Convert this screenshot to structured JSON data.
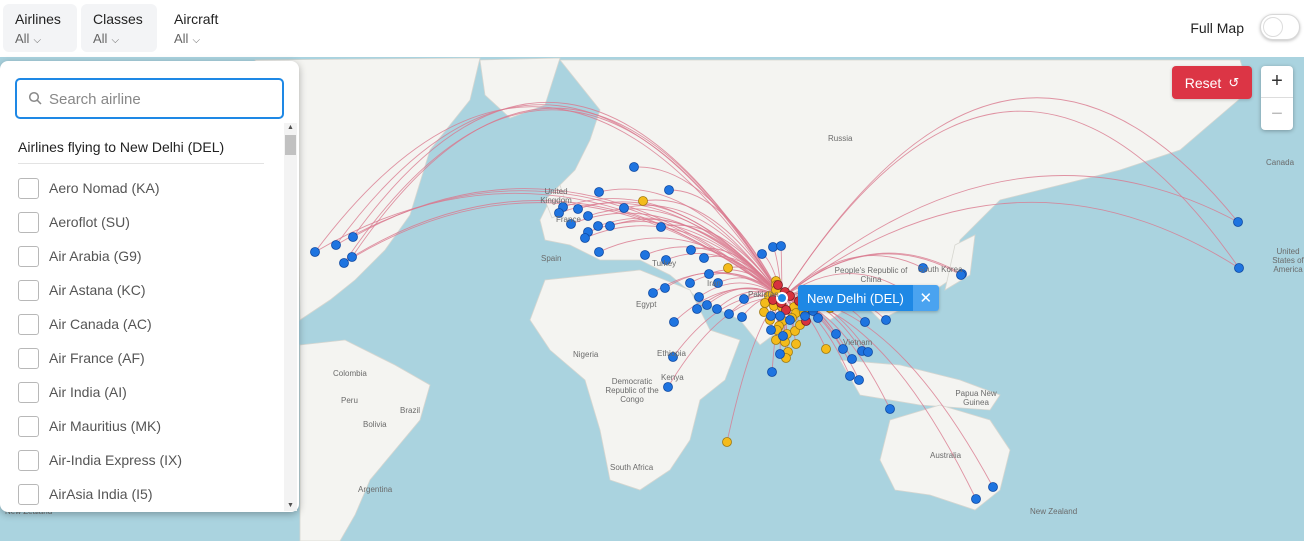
{
  "filters": [
    {
      "label": "Airlines",
      "value": "All"
    },
    {
      "label": "Classes",
      "value": "All"
    },
    {
      "label": "Aircraft",
      "value": "All"
    }
  ],
  "full_map": {
    "label": "Full Map",
    "enabled": false
  },
  "reset_label": "Reset",
  "zoom": {
    "in": "+",
    "out": "−"
  },
  "panel": {
    "search_placeholder": "Search airline",
    "title": "Airlines flying to New Delhi (DEL)",
    "items": [
      "Aero Nomad (KA)",
      "Aeroflot (SU)",
      "Air Arabia (G9)",
      "Air Astana (KC)",
      "Air Canada (AC)",
      "Air France (AF)",
      "Air India (AI)",
      "Air Mauritius (MK)",
      "Air-India Express (IX)",
      "AirAsia India (I5)"
    ]
  },
  "popup": {
    "label": "New Delhi (DEL)",
    "close": "✕"
  },
  "map_labels": {
    "russia": "Russia",
    "canada": "Canada",
    "uk": "United Kingdom",
    "france": "France",
    "spain": "Spain",
    "turkey": "Turkey",
    "iran": "Iran",
    "egypt": "Egypt",
    "nigeria": "Nigeria",
    "ethiopia": "Ethiopia",
    "kenya": "Kenya",
    "drc": "Democratic Republic of the Congo",
    "south_africa": "South Africa",
    "china": "People's Republic of China",
    "korea": "South Korea",
    "vietnam": "Vietnam",
    "png": "Papua New Guinea",
    "australia": "Australia",
    "new_zealand": "New Zealand",
    "new_zealand_left": "New Zealand",
    "colombia": "Colombia",
    "peru": "Peru",
    "brazil": "Brazil",
    "bolivia": "Bolivia",
    "argentina": "Argentina",
    "united_states": "United States of America",
    "pakistan": "Pakistan"
  },
  "colors": {
    "ocean": "#aad3df",
    "land": "#f4f4f1",
    "route": "#d9798f",
    "airport_blue": "#1e74e0",
    "airport_yellow": "#f4bb1b",
    "airport_red": "#d7323e",
    "accent": "#1e88e5",
    "reset": "#dc3545"
  },
  "airports": {
    "hub": "DEL",
    "destination_markers": "blue-yellow-red dots"
  }
}
